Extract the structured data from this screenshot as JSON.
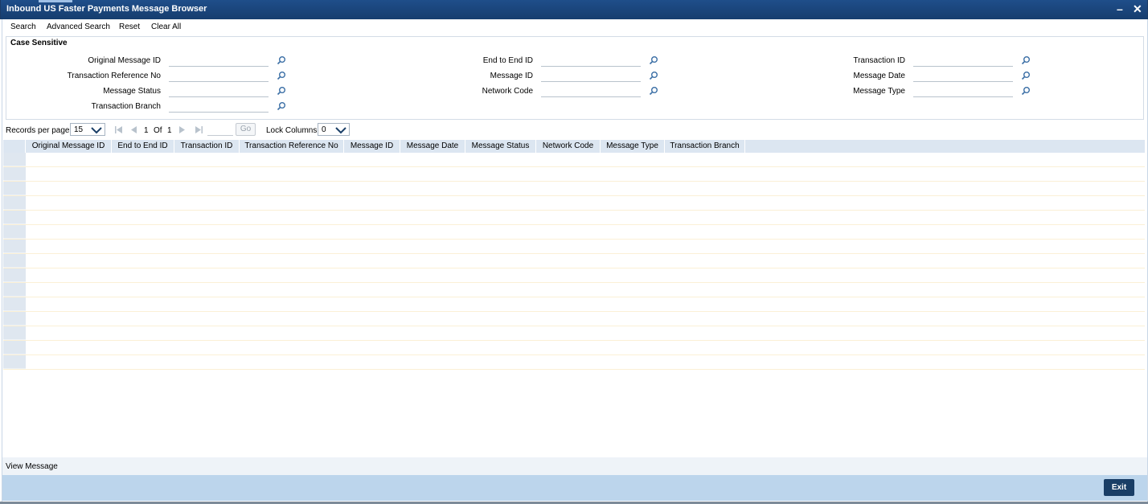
{
  "window": {
    "title": "Inbound US Faster Payments Message Browser",
    "minimize": "–",
    "close": "✕"
  },
  "toolbar": {
    "search": "Search",
    "advanced_search": "Advanced Search",
    "reset": "Reset",
    "clear_all": "Clear All"
  },
  "criteria": {
    "section_label": "Case Sensitive",
    "fields": {
      "original_message_id": {
        "label": "Original Message ID",
        "value": ""
      },
      "transaction_reference_no": {
        "label": "Transaction Reference No",
        "value": ""
      },
      "message_status": {
        "label": "Message Status",
        "value": ""
      },
      "transaction_branch": {
        "label": "Transaction Branch",
        "value": ""
      },
      "end_to_end_id": {
        "label": "End to End ID",
        "value": ""
      },
      "message_id": {
        "label": "Message ID",
        "value": ""
      },
      "network_code": {
        "label": "Network Code",
        "value": ""
      },
      "transaction_id": {
        "label": "Transaction ID",
        "value": ""
      },
      "message_date": {
        "label": "Message Date",
        "value": ""
      },
      "message_type": {
        "label": "Message Type",
        "value": ""
      }
    }
  },
  "pager": {
    "records_label": "Records per page",
    "records_value": "15",
    "current_page": "1",
    "of_label": "Of",
    "total_pages": "1",
    "go_label": "Go",
    "lock_label": "Lock Columns",
    "lock_value": "0"
  },
  "grid": {
    "columns": [
      "Original Message ID",
      "End to End ID",
      "Transaction ID",
      "Transaction Reference No",
      "Message ID",
      "Message Date",
      "Message Status",
      "Network Code",
      "Message Type",
      "Transaction Branch"
    ],
    "row_count": 15
  },
  "footer": {
    "view_message": "View Message",
    "exit": "Exit"
  },
  "colors": {
    "title_bar": "#1f4e8a",
    "grid_header": "#dce6f1",
    "footer_bar": "#bcd5ec",
    "exit_button": "#1a3e66",
    "lov_icon": "#3a6ea5"
  }
}
